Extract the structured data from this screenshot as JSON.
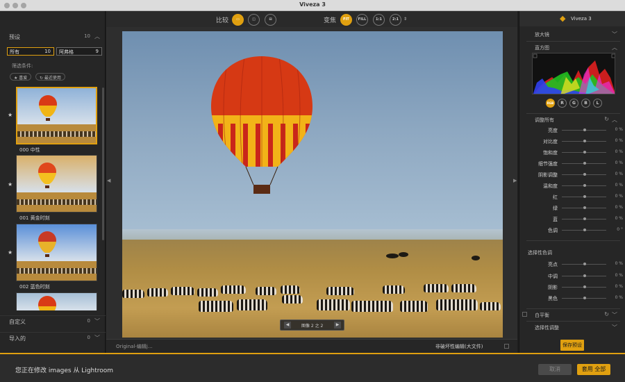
{
  "window": {
    "title": "Viveza 3"
  },
  "left_panel": {
    "presets_label": "预设",
    "presets_count": "10",
    "filters": [
      {
        "label": "所有",
        "count": "10"
      },
      {
        "label": "阿弗格",
        "count": "9"
      }
    ],
    "filter_conditions_label": "筛选条件:",
    "chips": [
      "★ 喜爱",
      "↻ 最近使用"
    ],
    "presets": [
      {
        "name": "000 中性",
        "sky": "#8fb2d8"
      },
      {
        "name": "001 黄金时刻",
        "sky": "#d9b06a"
      },
      {
        "name": "002 蓝色时刻",
        "sky": "#5a8fd8"
      },
      {
        "name": "",
        "sky": "#a6bfd6"
      }
    ],
    "custom_label": "自定义",
    "custom_count": "0",
    "imported_label": "导入的",
    "imported_count": "0"
  },
  "center_panel": {
    "compare_label": "比较",
    "zoom_label": "变焦",
    "zoom_options": [
      "FIT",
      "FILL",
      "1:1",
      "2:1"
    ],
    "image_counter": "图像 2 之 2",
    "status_left": "Original-编辑j...",
    "status_right": "非破坏性编辑(大文件)"
  },
  "right_panel": {
    "brand": "Viveza 3",
    "loupe_label": "放大镜",
    "histogram_label": "直方图",
    "histogram_channels": [
      "RGB",
      "R",
      "G",
      "B",
      "L"
    ],
    "adjust_all_label": "调整所有",
    "sliders": [
      {
        "label": "亮度",
        "value": "0 %"
      },
      {
        "label": "对比度",
        "value": "0 %"
      },
      {
        "label": "饱和度",
        "value": "0 %"
      },
      {
        "label": "细节强度",
        "value": "0 %"
      },
      {
        "label": "阴影调整",
        "value": "0 %"
      },
      {
        "label": "温和度",
        "value": "0 %"
      },
      {
        "label": "红",
        "value": "0 %"
      },
      {
        "label": "绿",
        "value": "0 %"
      },
      {
        "label": "蓝",
        "value": "0 %"
      },
      {
        "label": "色调",
        "value": "0 °"
      }
    ],
    "selective_tone_label": "选择性色调",
    "tone_sliders": [
      {
        "label": "亮点",
        "value": "0 %"
      },
      {
        "label": "中调",
        "value": "0 %"
      },
      {
        "label": "阴影",
        "value": "0 %"
      },
      {
        "label": "黑色",
        "value": "0 %"
      }
    ],
    "white_balance_label": "白平衡",
    "selective_adjust_label": "选择性调整",
    "save_preset_label": "保存预设"
  },
  "bottom_bar": {
    "message": "您正在修改 images 从 Lightroom",
    "cancel_label": "取消",
    "apply_label": "套用 全部"
  },
  "colors": {
    "accent": "#e0a010",
    "panel": "#262626"
  }
}
